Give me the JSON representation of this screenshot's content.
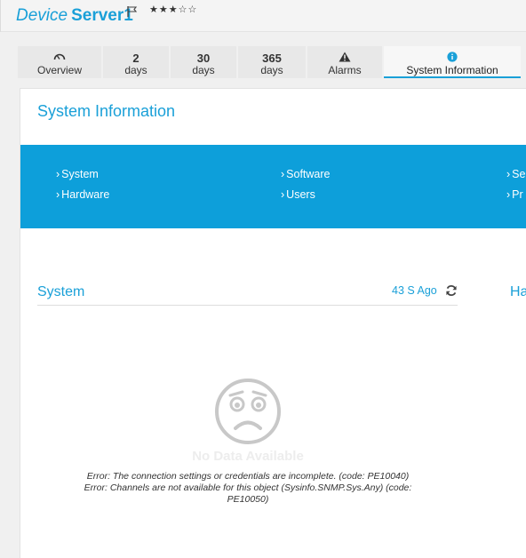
{
  "header": {
    "prefix": "Device",
    "name": "Server1",
    "flag_icon": "flag-icon",
    "stars": "★★★☆☆"
  },
  "tabs": [
    {
      "top": "",
      "bottom": "Overview",
      "icon": "gauge-icon",
      "active": false
    },
    {
      "top": "2",
      "bottom": "days",
      "active": false
    },
    {
      "top": "30",
      "bottom": "days",
      "active": false
    },
    {
      "top": "365",
      "bottom": "days",
      "active": false
    },
    {
      "top": "",
      "bottom": "Alarms",
      "icon": "warning-icon",
      "active": false
    },
    {
      "top": "",
      "bottom": "System Information",
      "icon": "info-icon",
      "active": true
    }
  ],
  "panel": {
    "title": "System Information"
  },
  "nav": {
    "chevron": "›",
    "system": "System",
    "hardware": "Hardware",
    "software": "Software",
    "users": "Users",
    "services_partial": "Se",
    "processes_partial": "Pr"
  },
  "system_section": {
    "title": "System",
    "refresh_time": "43 S Ago",
    "refresh_icon": "refresh-icon",
    "next_section_partial": "Ha"
  },
  "empty_state": {
    "icon": "sad-face-icon",
    "message": "No Data Available",
    "errors": [
      "Error: The connection settings or credentials are incomplete. (code: PE10040)",
      "Error: Channels are not available for this object (Sysinfo.SNMP.Sys.Any) (code: PE10050)"
    ]
  },
  "colors": {
    "accent": "#1aa0d8",
    "banner": "#0d9fda",
    "tab_bg": "#e8e8e8"
  }
}
